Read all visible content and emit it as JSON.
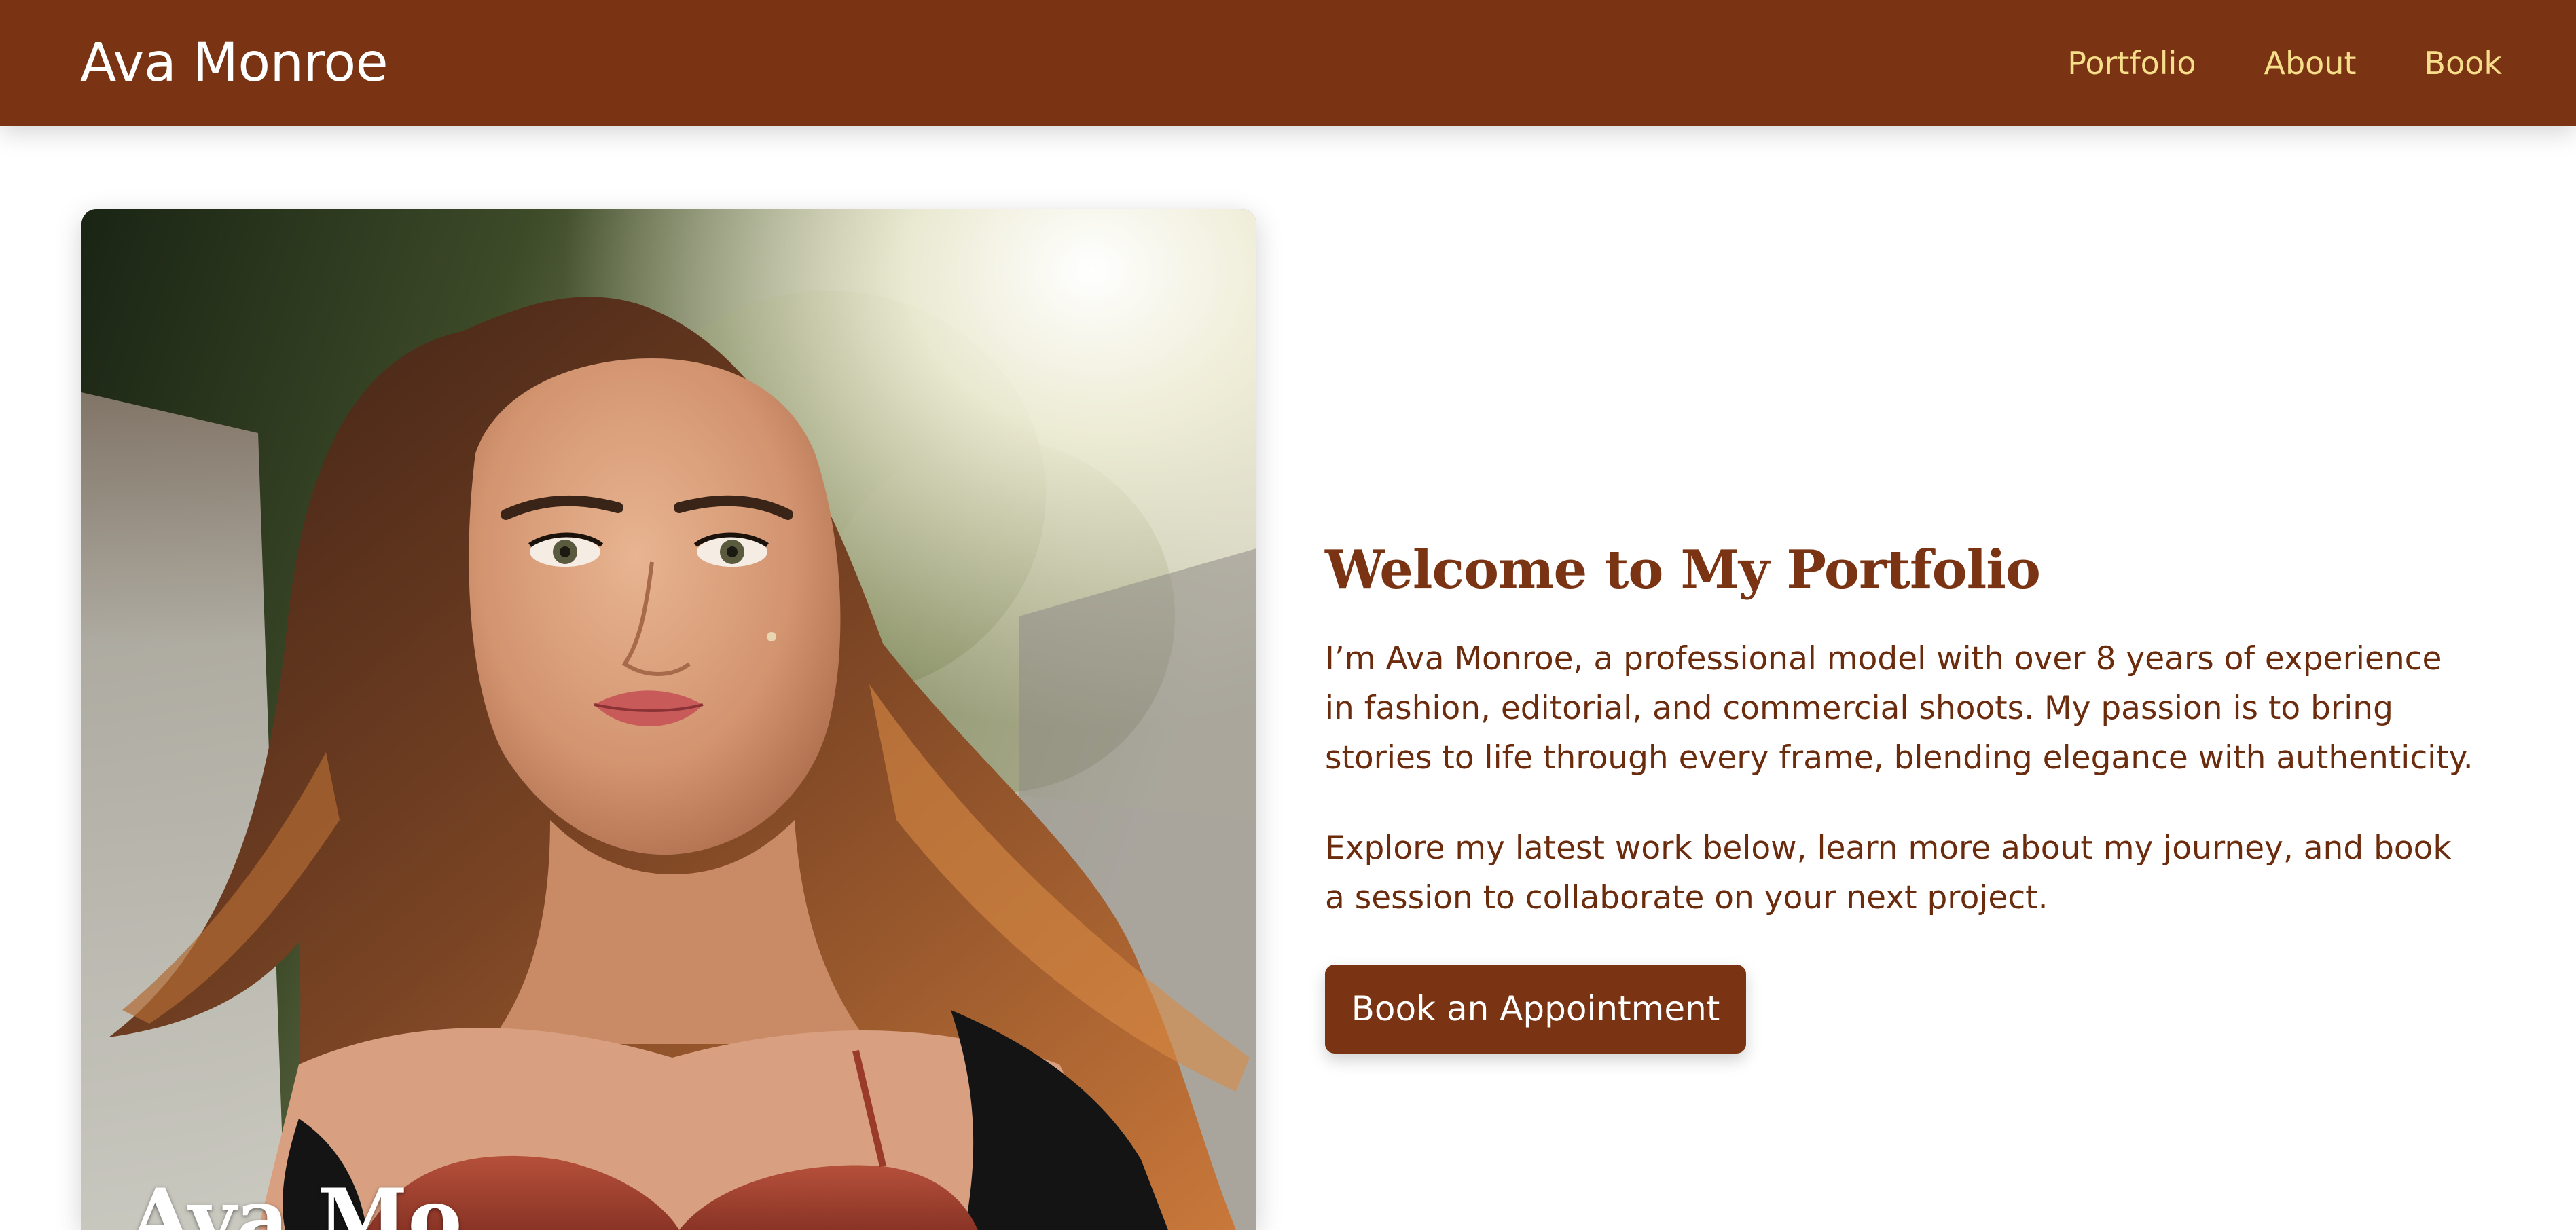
{
  "header": {
    "brand": "Ava Monroe",
    "nav": [
      "Portfolio",
      "About",
      "Book"
    ]
  },
  "hero": {
    "photo_caption": "Ava Mo",
    "title": "Welcome to My Portfolio",
    "paragraphs": [
      "I’m Ava Monroe, a professional model with over 8 years of experience in fashion, editorial, and commercial shoots. My passion is to bring stories to life through every frame, blending elegance with authenticity.",
      "Explore my latest work below, learn more about my journey, and book a session to collaborate on your next project."
    ],
    "cta": "Book an Appointment"
  },
  "colors": {
    "brand_brown": "#7a3413",
    "nav_gold": "#f7de8a",
    "body_text": "#6b2c0e"
  }
}
